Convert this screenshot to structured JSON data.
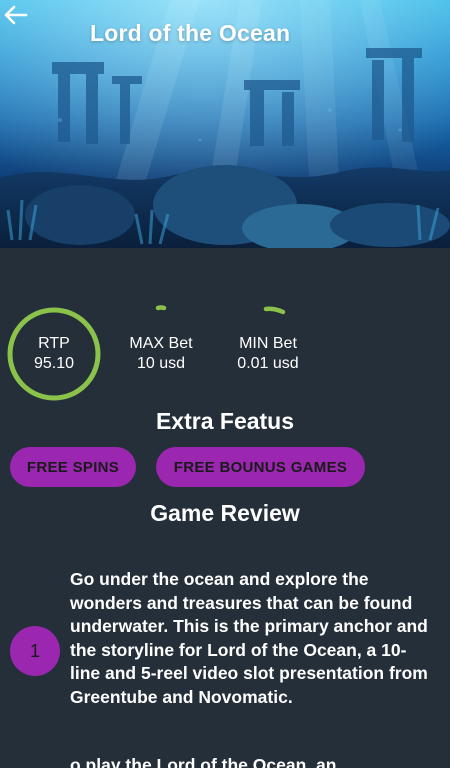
{
  "header": {
    "title": "Lord of the Ocean",
    "back_icon": "arrow-left-icon"
  },
  "stats": {
    "rtp": {
      "label": "RTP",
      "value": "95.10",
      "ring_fraction": 1.0
    },
    "max_bet": {
      "label": "MAX Bet",
      "value": "10 usd"
    },
    "min_bet": {
      "label": "MIN Bet",
      "value": "0.01 usd"
    }
  },
  "colors": {
    "background": "#252f39",
    "ring": "#8bc34a",
    "accent": "#9b27b0"
  },
  "sections": {
    "extra_features_title": "Extra Featus",
    "game_review_title": "Game Review"
  },
  "features": [
    "FREE SPINS",
    "FREE BOUNUS GAMES"
  ],
  "review": {
    "items": [
      {
        "number": "1",
        "text": "Go under the ocean and explore the wonders and treasures that can be found underwater. This is the primary anchor and the storyline for Lord of the Ocean, a 10-line and 5-reel video slot presentation from Greentube and Novomatic."
      }
    ],
    "next_paragraph": "o play the Lord of the Ocean, an"
  }
}
